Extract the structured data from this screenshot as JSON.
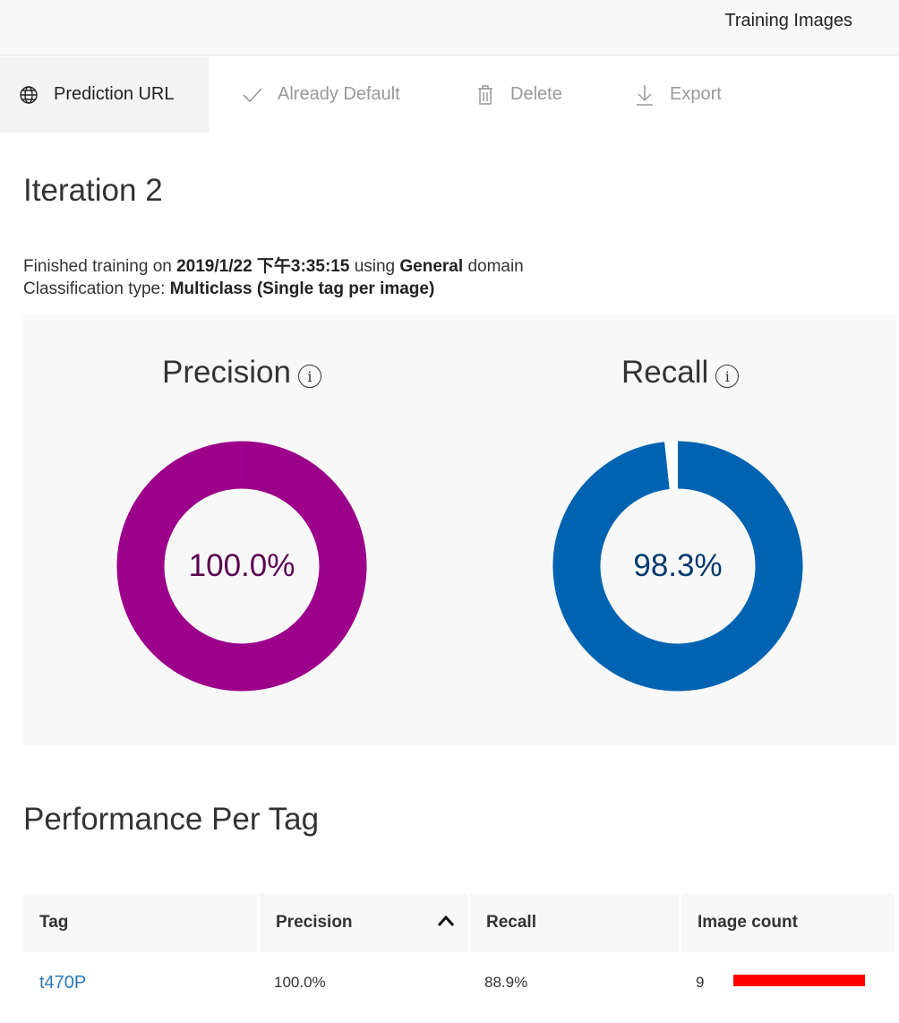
{
  "header": {
    "training_images_label": "Training Images"
  },
  "toolbar": {
    "prediction_url_label": "Prediction URL",
    "already_default_label": "Already Default",
    "delete_label": "Delete",
    "export_label": "Export"
  },
  "iteration": {
    "title": "Iteration 2",
    "finished_prefix": "Finished training on",
    "finished_date": "2019/1/22 下午3:35:15",
    "using_text": "using",
    "domain_name": "General",
    "domain_suffix": "domain",
    "classification_prefix": "Classification type:",
    "classification_type": "Multiclass (Single tag per image)"
  },
  "metrics": {
    "precision": {
      "label": "Precision",
      "value_text": "100.0%",
      "value": 100.0,
      "color": "#9c008a"
    },
    "recall": {
      "label": "Recall",
      "value_text": "98.3%",
      "value": 98.3,
      "color": "#0063b1"
    },
    "info_glyph": "i"
  },
  "performance": {
    "title": "Performance Per Tag",
    "columns": [
      "Tag",
      "Precision",
      "Recall",
      "Image count"
    ],
    "sorted_column": "Precision",
    "rows": [
      {
        "tag": "t470P",
        "precision": "100.0%",
        "recall": "88.9%",
        "image_count": "9",
        "image_count_fraction": 1.0,
        "bar_color": "#ff0000"
      }
    ]
  }
}
